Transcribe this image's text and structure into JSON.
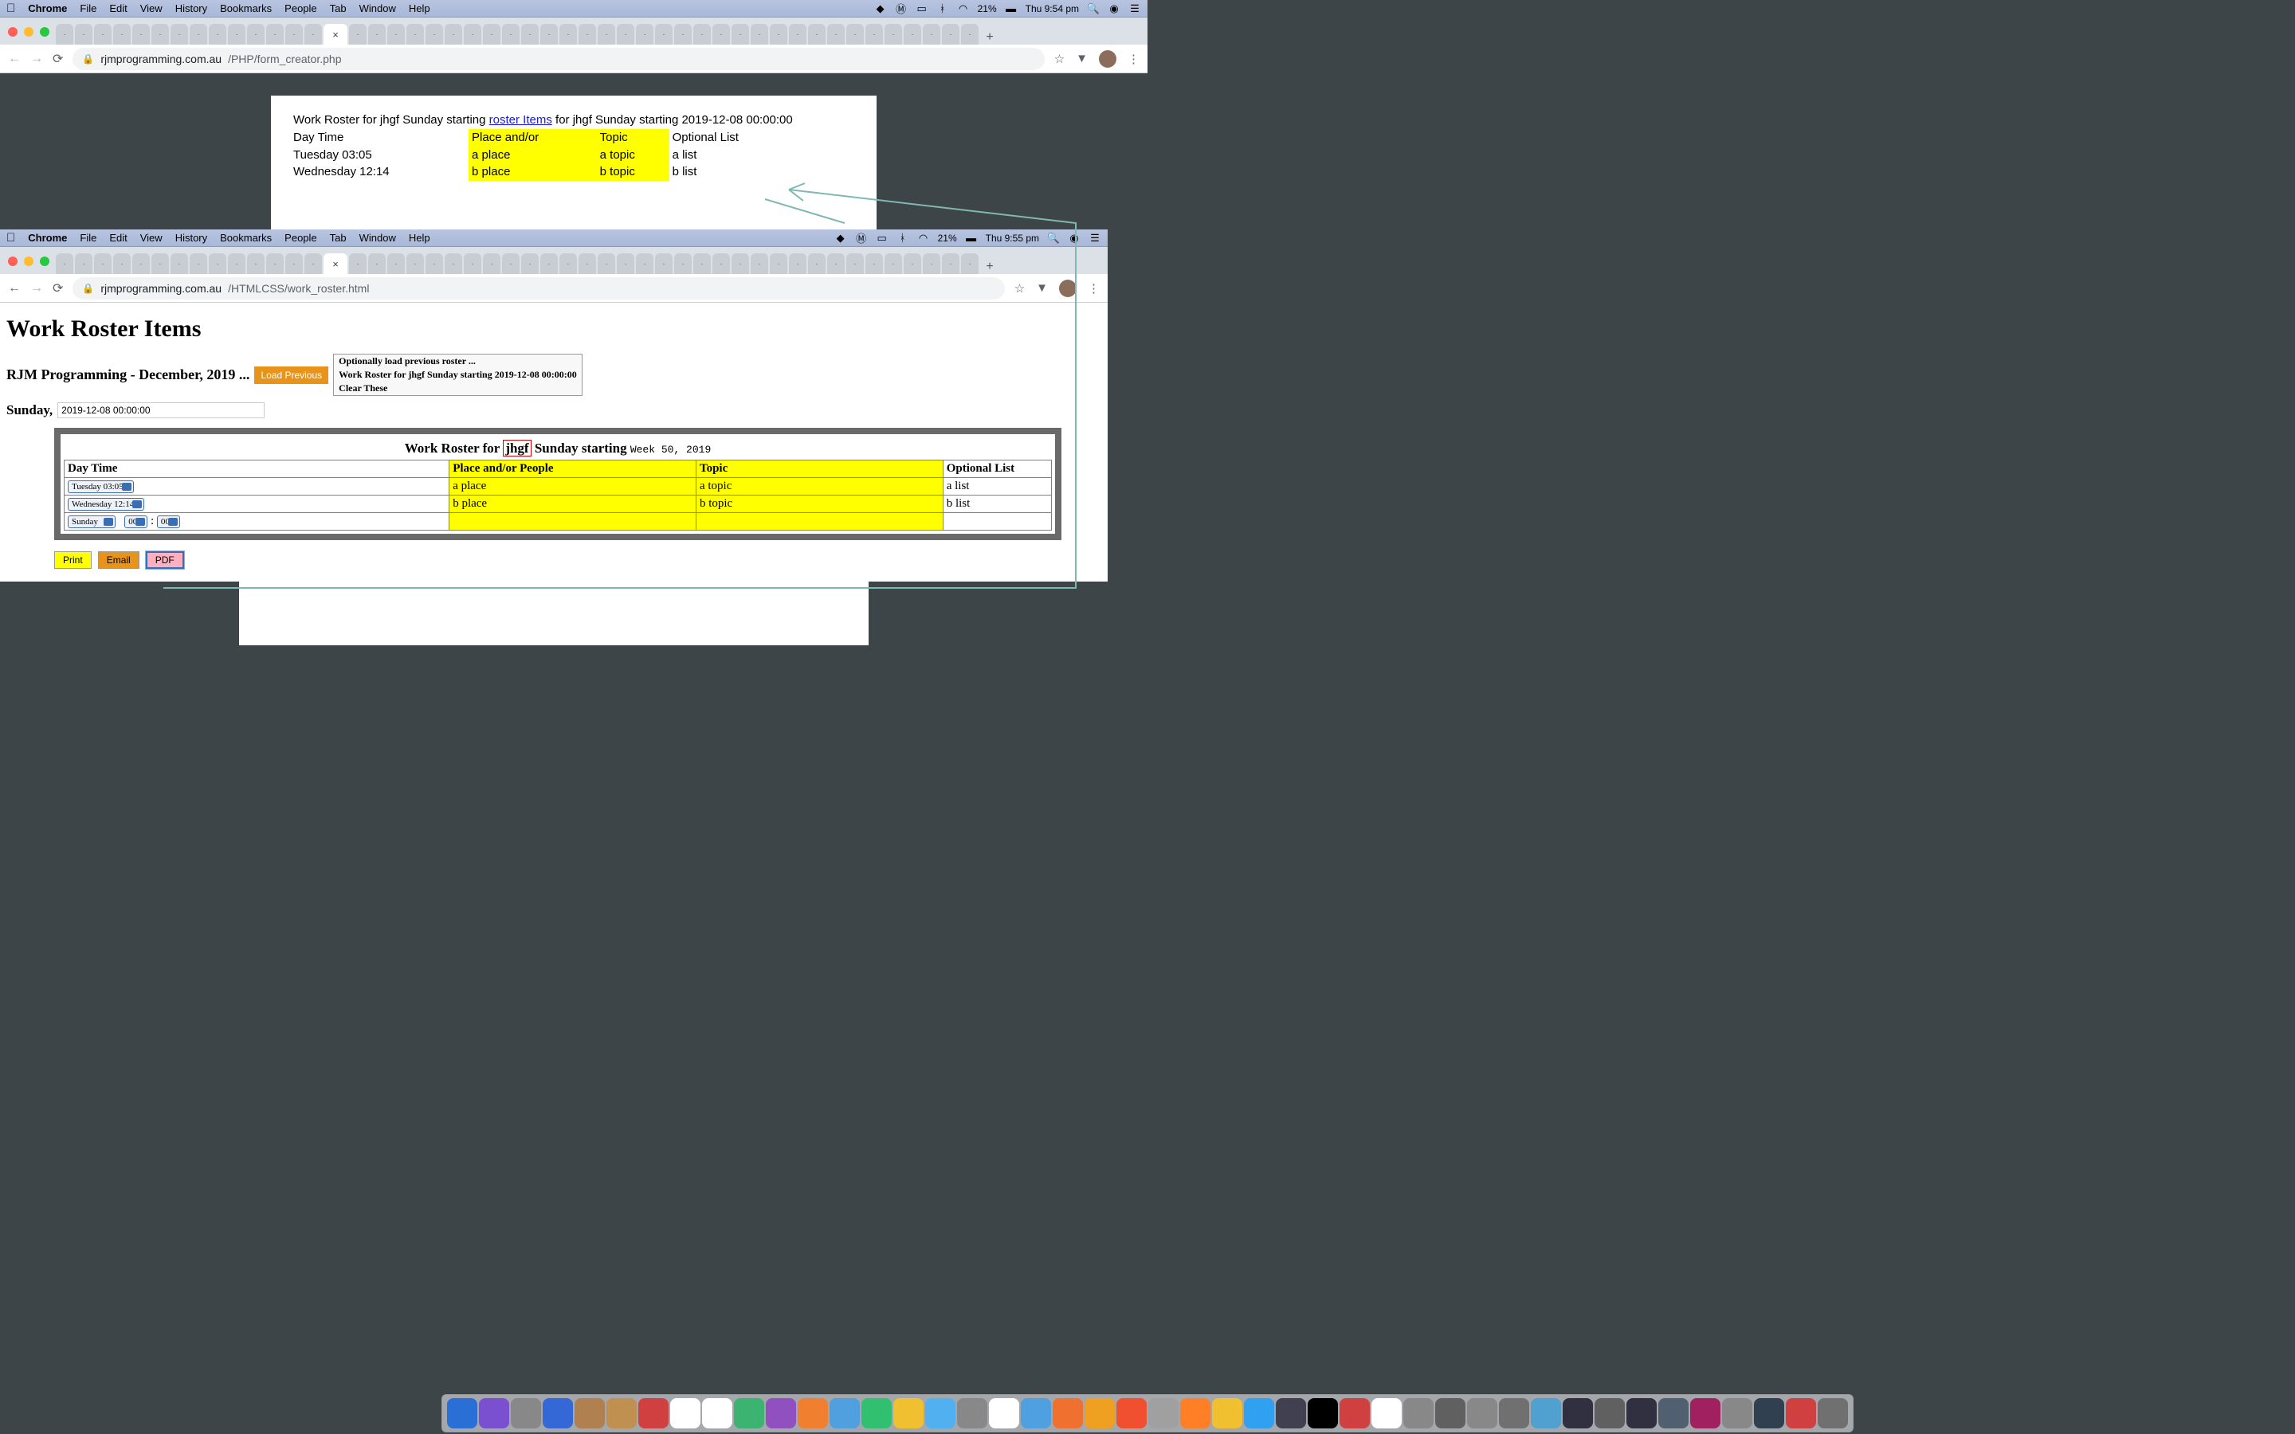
{
  "menubar_top": {
    "app": "Chrome",
    "items": [
      "File",
      "Edit",
      "View",
      "History",
      "Bookmarks",
      "People",
      "Tab",
      "Window",
      "Help"
    ],
    "battery": "21%",
    "clock": "Thu 9:54 pm"
  },
  "menubar_second": {
    "app": "Chrome",
    "items": [
      "File",
      "Edit",
      "View",
      "History",
      "Bookmarks",
      "People",
      "Tab",
      "Window",
      "Help"
    ],
    "battery": "21%",
    "clock": "Thu 9:55 pm"
  },
  "top_window": {
    "url_domain": "rjmprogramming.com.au",
    "url_path": "/PHP/form_creator.php",
    "doc": {
      "line1_a": "Work Roster for jhgf  Sunday starting ",
      "line1_link": "roster Items",
      "line1_b": " for jhgf  Sunday starting 2019-12-08 00:00:00",
      "headers": {
        "day": "Day Time",
        "place": "Place and/or",
        "topic": "Topic",
        "optional": "Optional List"
      },
      "rows": [
        {
          "day": "Tuesday 03:05",
          "place": "a place",
          "topic": "a topic",
          "optional": "a list"
        },
        {
          "day": "Wednesday 12:14",
          "place": "b place",
          "topic": "b topic",
          "optional": "b list"
        }
      ]
    }
  },
  "second_window": {
    "url_domain": "rjmprogramming.com.au",
    "url_path": "/HTMLCSS/work_roster.html",
    "page": {
      "h1": "Work Roster Items",
      "subtitle": "RJM Programming - December, 2019 ...",
      "load_btn": "Load Previous",
      "loadbox": [
        "Optionally load previous roster ...",
        "Work Roster for jhgf Sunday starting 2019-12-08 00:00:00",
        "Clear These"
      ],
      "sunday_label": "Sunday,",
      "sunday_value": "2019-12-08 00:00:00",
      "table_caption_a": "Work Roster for ",
      "table_caption_name": "jhgf",
      "table_caption_b": " Sunday starting ",
      "table_caption_week": "Week 50, 2019",
      "headers": {
        "day": "Day Time",
        "place": "Place and/or People",
        "topic": "Topic",
        "optional": "Optional List"
      },
      "rows": [
        {
          "day": "Tuesday 03:05",
          "place": "a place",
          "topic": "a topic",
          "optional": "a list"
        },
        {
          "day": "Wednesday 12:14",
          "place": "b place",
          "topic": "b topic",
          "optional": "b list"
        }
      ],
      "blank_row": {
        "day": "Sunday",
        "h": "00",
        "m": "00"
      },
      "buttons": {
        "print": "Print",
        "email": "Email",
        "pdf": "PDF"
      }
    }
  },
  "tab_count": 48,
  "active_tab_index": 14
}
